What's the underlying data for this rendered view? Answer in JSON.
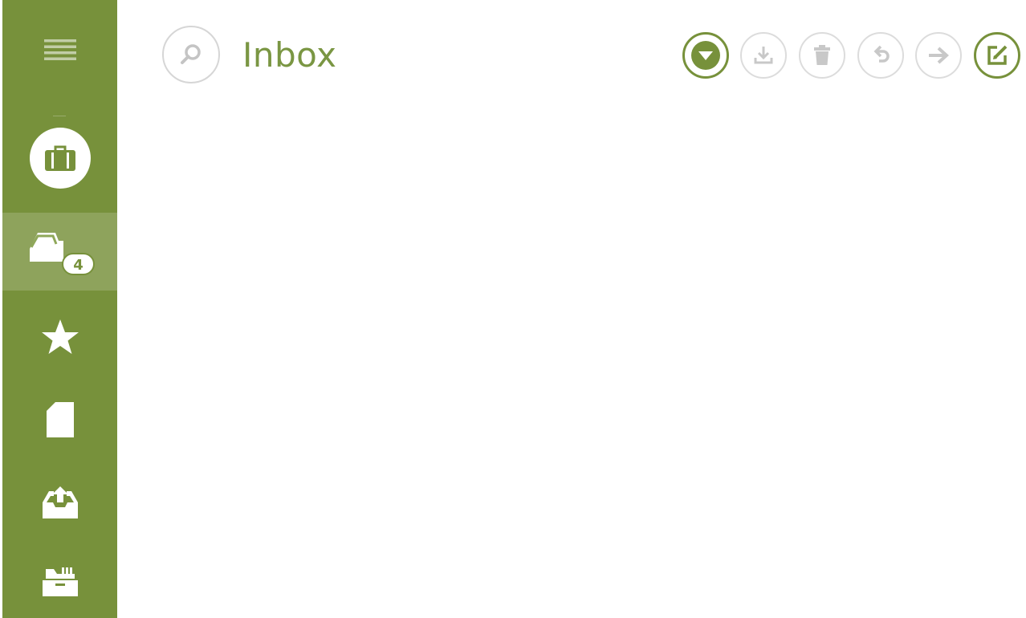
{
  "header": {
    "title": "Inbox"
  },
  "sidebar": {
    "items": [
      {
        "id": "menu",
        "icon": "menu-icon"
      },
      {
        "id": "briefcase",
        "icon": "briefcase-icon"
      },
      {
        "id": "inbox",
        "icon": "inbox-tray-icon",
        "badge": "4",
        "selected": true
      },
      {
        "id": "starred",
        "icon": "star-icon"
      },
      {
        "id": "drafts",
        "icon": "document-icon"
      },
      {
        "id": "sent",
        "icon": "outbox-tray-icon"
      },
      {
        "id": "archive",
        "icon": "archive-box-icon"
      }
    ]
  },
  "toolbar": {
    "buttons": [
      {
        "id": "dropdown",
        "icon": "triangle-down-icon",
        "enabled": true
      },
      {
        "id": "download",
        "icon": "download-icon",
        "enabled": false
      },
      {
        "id": "delete",
        "icon": "trash-icon",
        "enabled": false
      },
      {
        "id": "reply",
        "icon": "reply-icon",
        "enabled": false
      },
      {
        "id": "forward",
        "icon": "arrow-right-icon",
        "enabled": false
      },
      {
        "id": "compose",
        "icon": "compose-icon",
        "enabled": true
      }
    ]
  },
  "colors": {
    "accent": "#77913b",
    "title": "#7a9643",
    "disabled": "#dcdcdc",
    "icon_disabled": "#c8c8c8",
    "white": "#ffffff"
  }
}
